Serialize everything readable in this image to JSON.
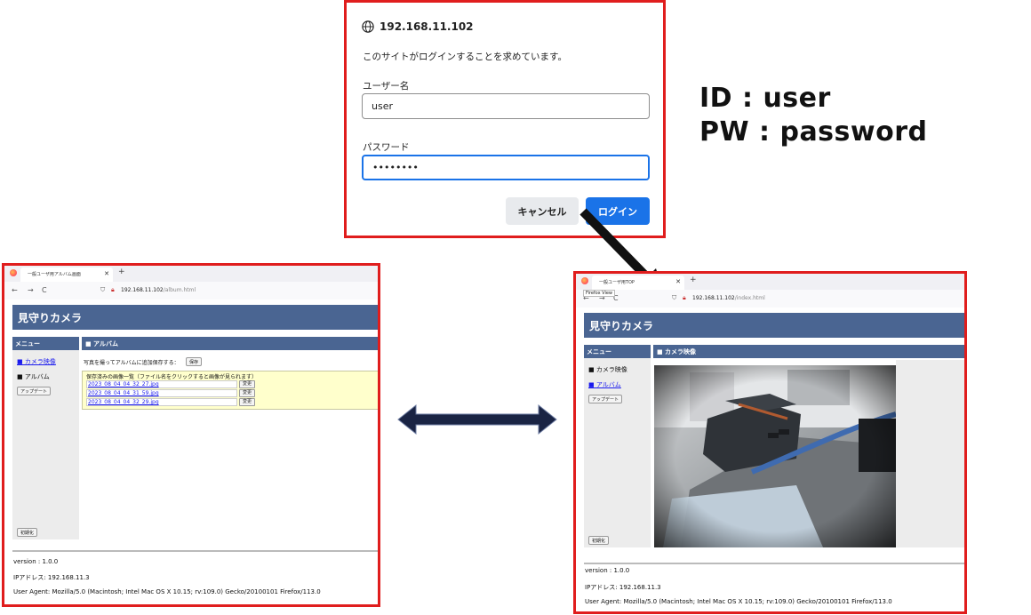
{
  "login": {
    "site": "192.168.11.102",
    "message": "このサイトがログインすることを求めています。",
    "username_label": "ユーザー名",
    "username_value": "user",
    "password_label": "パスワード",
    "password_value": "••••••••",
    "cancel_label": "キャンセル",
    "login_label": "ログイン"
  },
  "credentials": {
    "id_line": "ID : user",
    "pw_line": "PW : password"
  },
  "album_window": {
    "tab_title": "一般ユーザ用アルバム画面",
    "url_host": "192.168.11.102",
    "url_path": "/album.html",
    "app_title": "見守りカメラ",
    "menu_title": "メニュー",
    "section_title": "■ アルバム",
    "menu_camera": "■ カメラ映像",
    "menu_album": "■ アルバム",
    "update_btn": "アップデート",
    "reset_btn": "初期化",
    "save_prompt": "写真を撮ってアルバムに追加保存する：",
    "save_btn": "保存",
    "list_header": "保存済みの画像一覧（ファイル名をクリックすると画像が見られます）",
    "files": [
      {
        "name": "2023_08_04_04_32_27.jpg",
        "action": "変更"
      },
      {
        "name": "2023_08_04_04_31_59.jpg",
        "action": "変更"
      },
      {
        "name": "2023_08_04_04_32_29.jpg",
        "action": "変更"
      }
    ],
    "version": "version : 1.0.0",
    "ip": "IPアドレス: 192.168.11.3",
    "user_agent": "User Agent: Mozilla/5.0 (Macintosh; Intel Mac OS X 10.15; rv:109.0) Gecko/20100101 Firefox/113.0"
  },
  "camera_window": {
    "tab_title": "一般ユーザ用TOP",
    "tooltip": "Firefox View",
    "url_host": "192.168.11.102",
    "url_path": "/index.html",
    "app_title": "見守りカメラ",
    "menu_title": "メニュー",
    "section_title": "■ カメラ映像",
    "menu_camera": "■ カメラ映像",
    "menu_album": "■ アルバム",
    "update_btn": "アップデート",
    "reset_btn": "初期化",
    "version": "version : 1.0.0",
    "ip": "IPアドレス: 192.168.11.3",
    "user_agent": "User Agent: Mozilla/5.0 (Macintosh; Intel Mac OS X 10.15; rv:109.0) Gecko/20100101 Firefox/113.0"
  }
}
